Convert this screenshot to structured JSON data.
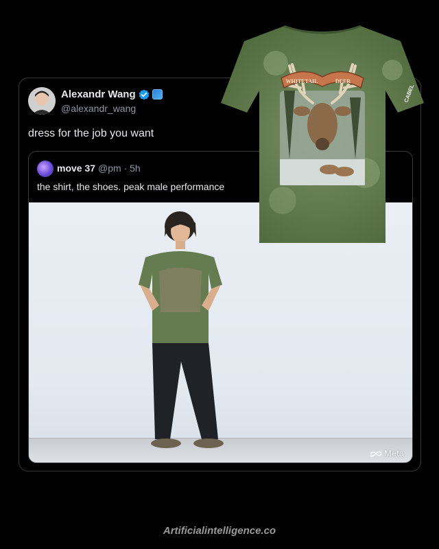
{
  "tweet": {
    "author_name": "Alexandr Wang",
    "author_handle": "@alexandr_wang",
    "text": "dress for the job you want"
  },
  "quote": {
    "author_name": "move 37",
    "handle_time": "@pm · 5h",
    "text": "the shirt, the shoes. peak male performance"
  },
  "photo": {
    "watermark": "Meta"
  },
  "shirt": {
    "banner_left": "WHITETAIL",
    "banner_right": "DEER",
    "sleeve_text": "CABEL"
  },
  "footer": {
    "credit": "Artificialintelligence.co"
  },
  "colors": {
    "background": "#000000",
    "verified": "#1d9bf0",
    "shirt_green": "#5f7a4a"
  }
}
